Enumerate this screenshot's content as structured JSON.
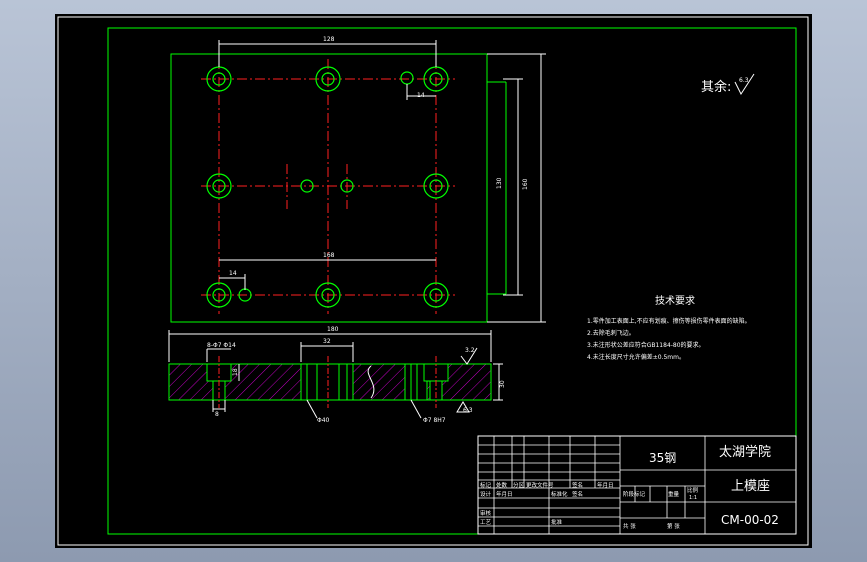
{
  "surface_finish": {
    "label": "其余:",
    "value": "6.3"
  },
  "tech_requirements": {
    "title": "技术要求",
    "items": [
      "1.零件加工表面上,不应有划痕、擦伤等损伤零件表面的缺陷。",
      "2.去除毛刺飞边。",
      "3.未注形状公差应符合GB1184-80的要求。",
      "4.未注长度尺寸允许偏差±0.5mm。"
    ]
  },
  "dimensions": {
    "top_width": "128",
    "inner_width": "168",
    "offset_top": "14",
    "offset_bottom": "14",
    "inner_height": "130",
    "outer_height": "160",
    "overall_width": "180",
    "section_width": "32",
    "section_height": "30",
    "depth": "18",
    "counterbore": "8-Φ7 Φ14",
    "hole_a": "Φ40",
    "hole_b": "Φ7 8H7",
    "bottom_dim": "8",
    "finish_section": "3.2",
    "finish_bottom": "6.3"
  },
  "title_block": {
    "material": "35钢",
    "school": "太湖学院",
    "part_name": "上模座",
    "drawing_no": "CM-00-02",
    "scale": "1:1",
    "labels_row1": [
      "标记",
      "处数",
      "分区",
      "更改文件号",
      "签名",
      "年月日"
    ],
    "labels_row2": [
      "设计",
      "标准化"
    ],
    "labels_row3": [
      "审核"
    ],
    "labels_row4": [
      "工艺",
      "批准"
    ],
    "stage_labels": [
      "阶段标记",
      "重量",
      "比例"
    ],
    "sheet_labels": [
      "共 张",
      "第 张"
    ],
    "designer_date": "签名",
    "std_date": "年月日"
  }
}
